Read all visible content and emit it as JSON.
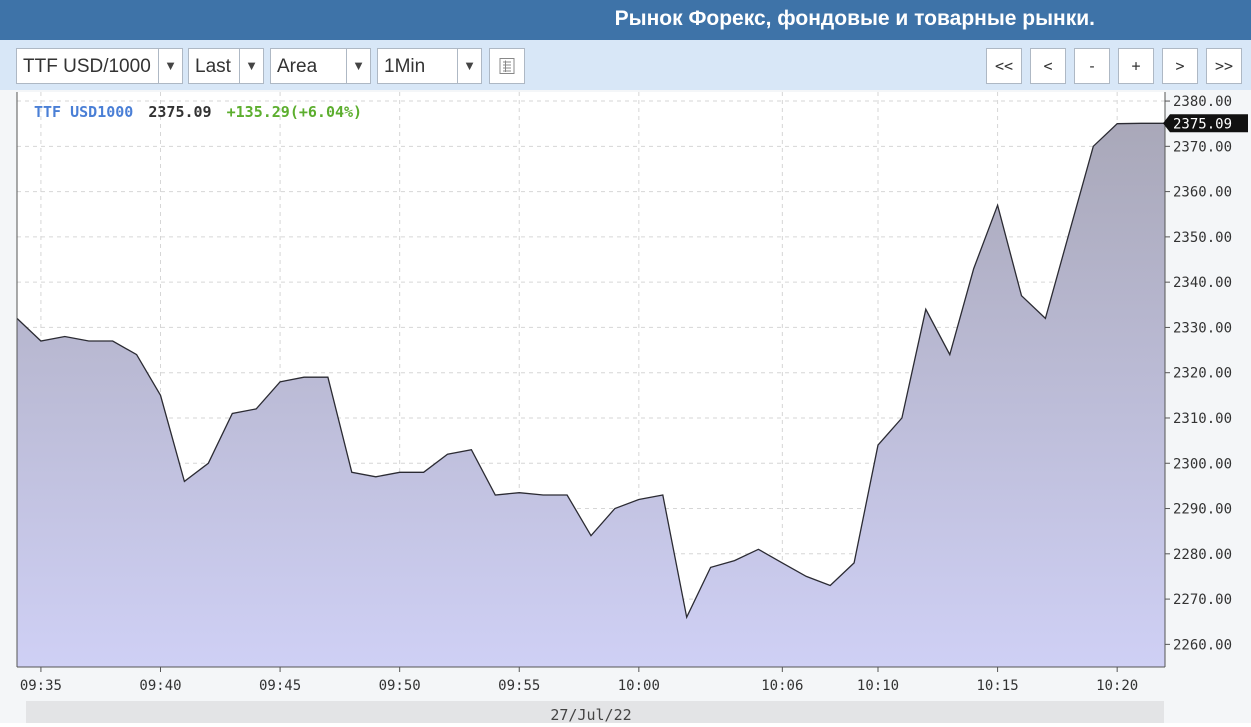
{
  "header": {
    "title": "Рынок Форекс, фондовые и товарные рынки."
  },
  "toolbar": {
    "symbol": "TTF USD/1000",
    "field": "Last",
    "chart_style": "Area",
    "interval": "1Min",
    "nav_buttons": [
      "<<",
      "<",
      "-",
      "+",
      ">",
      ">>"
    ]
  },
  "legend": {
    "name": "TTF USD1000",
    "price": "2375.09",
    "change": "+135.29(+6.04%)"
  },
  "colors": {
    "header": "#3e73a8",
    "legend_name": "#4a7fd6",
    "legend_change": "#5cae2e",
    "area_top": "#a9a8b9",
    "area_bottom": "#cfd0f5",
    "line": "#2b2b33"
  },
  "chart_data": {
    "type": "area",
    "x": [
      "09:34",
      "09:35",
      "09:36",
      "09:37",
      "09:38",
      "09:39",
      "09:40",
      "09:41",
      "09:42",
      "09:43",
      "09:44",
      "09:45",
      "09:46",
      "09:47",
      "09:48",
      "09:49",
      "09:50",
      "09:51",
      "09:52",
      "09:53",
      "09:54",
      "09:55",
      "09:56",
      "09:57",
      "09:58",
      "09:59",
      "10:00",
      "10:01",
      "10:02",
      "10:03",
      "10:04",
      "10:05",
      "10:06",
      "10:07",
      "10:08",
      "10:09",
      "10:10",
      "10:11",
      "10:12",
      "10:13",
      "10:14",
      "10:15",
      "10:16",
      "10:17",
      "10:18",
      "10:19",
      "10:20",
      "10:21",
      "10:22"
    ],
    "values": [
      2332,
      2327,
      2328,
      2327,
      2327,
      2324,
      2315,
      2296,
      2300,
      2311,
      2312,
      2318,
      2319,
      2319,
      2298,
      2297,
      2298,
      2298,
      2302,
      2303,
      2293,
      2293.5,
      2293,
      2293,
      2284,
      2290,
      2292,
      2293,
      2266,
      2277,
      2278.5,
      2281,
      2278,
      2275,
      2273,
      2278,
      2304,
      2310,
      2334,
      2324,
      2343,
      2357,
      2337,
      2332,
      2351,
      2370,
      2375,
      2375.09,
      2375.09
    ],
    "x_ticks": [
      "09:35",
      "09:40",
      "09:45",
      "09:50",
      "09:55",
      "10:00",
      "10:06",
      "10:10",
      "10:15",
      "10:20"
    ],
    "x_tick_index": [
      1,
      6,
      11,
      16,
      21,
      26,
      32,
      36,
      41,
      46
    ],
    "y_ticks": [
      "2260.00",
      "2270.00",
      "2280.00",
      "2290.00",
      "2300.00",
      "2310.00",
      "2320.00",
      "2330.00",
      "2340.00",
      "2350.00",
      "2360.00",
      "2370.00",
      "2380.00"
    ],
    "ylim": [
      2255,
      2382
    ],
    "last_price_label": "2375.09",
    "date_label": "27/Jul/22",
    "grid": true
  }
}
